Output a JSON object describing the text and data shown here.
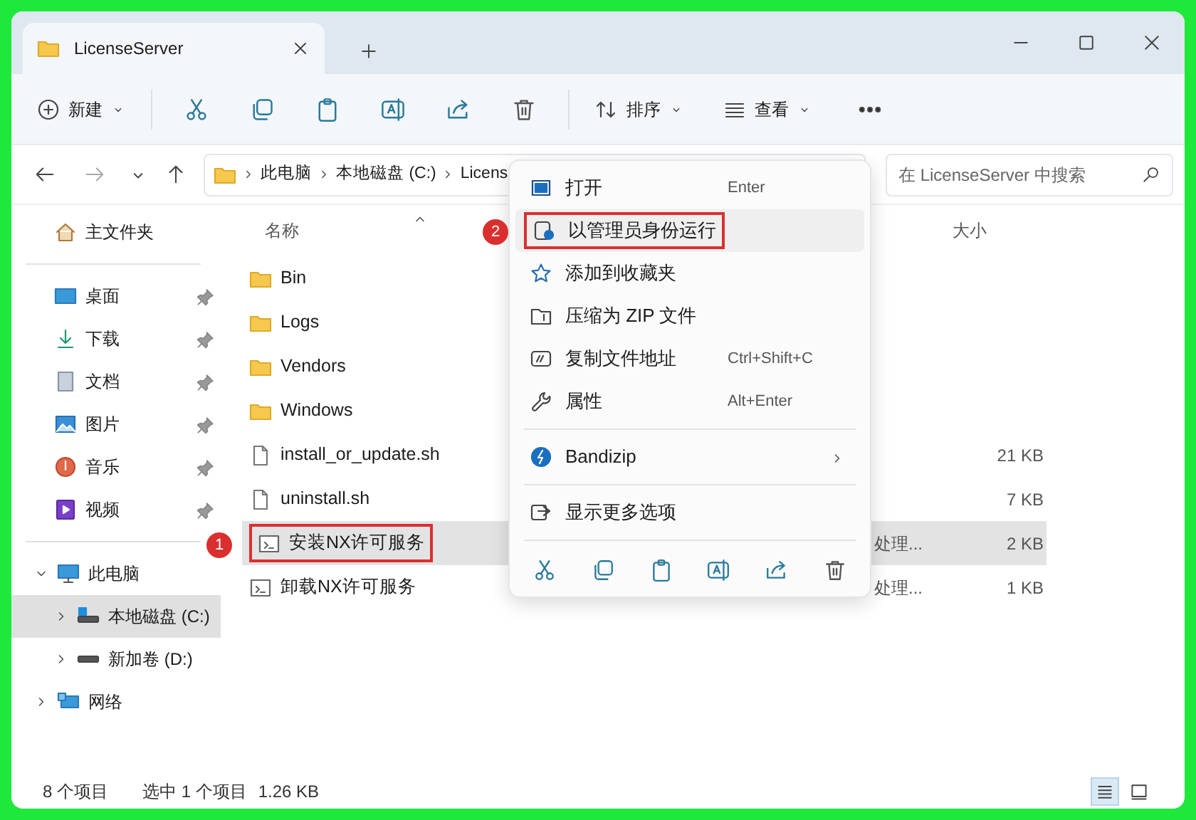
{
  "window": {
    "tab_title": "LicenseServer"
  },
  "toolbar": {
    "new_label": "新建",
    "sort_label": "排序",
    "view_label": "查看"
  },
  "address": {
    "breadcrumbs": [
      "此电脑",
      "本地磁盘 (C:)",
      "Licens"
    ],
    "search_placeholder": "在 LicenseServer 中搜索"
  },
  "sidebar": {
    "home": "主文件夹",
    "pinned": [
      {
        "label": "桌面",
        "pinned": true
      },
      {
        "label": "下载",
        "pinned": true
      },
      {
        "label": "文档",
        "pinned": true
      },
      {
        "label": "图片",
        "pinned": true
      },
      {
        "label": "音乐",
        "pinned": true
      },
      {
        "label": "视频",
        "pinned": true
      }
    ],
    "tree": [
      {
        "label": "此电脑",
        "expanded": true,
        "selected": false,
        "children": [
          {
            "label": "本地磁盘 (C:)",
            "expanded": false,
            "selected": true
          },
          {
            "label": "新加卷 (D:)",
            "expanded": false,
            "selected": false
          }
        ]
      },
      {
        "label": "网络",
        "expanded": false,
        "selected": false
      }
    ]
  },
  "file_list": {
    "columns": [
      "名称",
      "大小"
    ],
    "rows": [
      {
        "name": "Bin",
        "kind": "folder",
        "selected": false
      },
      {
        "name": "Logs",
        "kind": "folder",
        "selected": false
      },
      {
        "name": "Vendors",
        "kind": "folder",
        "selected": false
      },
      {
        "name": "Windows",
        "kind": "folder",
        "selected": false
      },
      {
        "name": "install_or_update.sh",
        "kind": "file",
        "size": "21 KB",
        "selected": false
      },
      {
        "name": "uninstall.sh",
        "kind": "file",
        "size": "7 KB",
        "selected": false
      },
      {
        "name": "安装NX许可服务",
        "kind": "script",
        "type": "处理...",
        "size": "2 KB",
        "selected": true,
        "callout": "1"
      },
      {
        "name": "卸载NX许可服务",
        "kind": "script",
        "type": "处理...",
        "size": "1 KB",
        "selected": false
      }
    ]
  },
  "context_menu": {
    "groups": [
      [
        {
          "label": "打开",
          "shortcut": "Enter",
          "hovered": false
        },
        {
          "label": "以管理员身份运行",
          "hovered": true,
          "callout": "2"
        },
        {
          "label": "添加到收藏夹",
          "hovered": false
        },
        {
          "label": "压缩为 ZIP 文件",
          "hovered": false
        },
        {
          "label": "复制文件地址",
          "shortcut": "Ctrl+Shift+C",
          "hovered": false
        },
        {
          "label": "属性",
          "shortcut": "Alt+Enter",
          "hovered": false
        }
      ],
      [
        {
          "label": "Bandizip",
          "hovered": false,
          "kind": "submenu"
        }
      ],
      [
        {
          "label": "显示更多选项",
          "hovered": false
        }
      ]
    ]
  },
  "status_bar": {
    "item_count": "8 个项目",
    "selection": "选中 1 个项目",
    "selection_size": "1.26 KB",
    "views": [
      {
        "selected": true
      },
      {
        "selected": false
      }
    ]
  }
}
